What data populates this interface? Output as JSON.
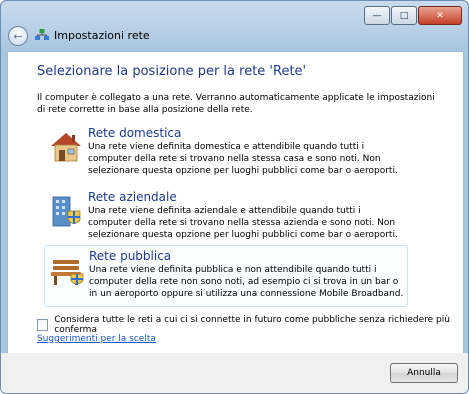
{
  "window": {
    "title": "Impostazioni rete",
    "caption_buttons": [
      "minimize-icon",
      "maximize-icon",
      "close-icon"
    ],
    "back_icon": "back-arrow-icon",
    "title_icon": "network-icon"
  },
  "main": {
    "heading": "Selezionare la posizione per la rete 'Rete'",
    "intro": "Il computer è collegato a una rete. Verranno automaticamente applicate le impostazioni di rete corrette in base alla posizione della rete.",
    "options": [
      {
        "title": "Rete domestica",
        "description": "Una rete viene definita domestica e attendibile quando tutti i computer della rete si trovano nella stessa casa e sono noti. Non selezionare questa opzione per luoghi pubblici come bar o aeroporti.",
        "icon": "house-icon"
      },
      {
        "title": "Rete aziendale",
        "description": "Una rete viene definita aziendale e attendibile quando tutti i computer della rete si trovano nella stessa azienda e sono noti. Non selezionare questa opzione per luoghi pubblici come bar o aeroporti.",
        "icon": "office-building-icon"
      },
      {
        "title": "Rete pubblica",
        "description": "Una rete viene definita pubblica e non attendibile quando tutti i computer della rete non sono noti, ad esempio ci si trova in un bar o in un aeroporto oppure si utilizza una connessione Mobile Broadband.",
        "icon": "park-bench-icon"
      }
    ],
    "checkbox_label": "Considera tutte le reti a cui ci si connette in futuro come pubbliche senza richiedere più conferma",
    "checkbox_checked": false,
    "help_link": "Suggerimenti per la scelta"
  },
  "footer": {
    "cancel_label": "Annulla"
  },
  "colors": {
    "heading": "#1e3a8a",
    "link": "#1a56c6",
    "title_bar": "#b7cfe6"
  }
}
